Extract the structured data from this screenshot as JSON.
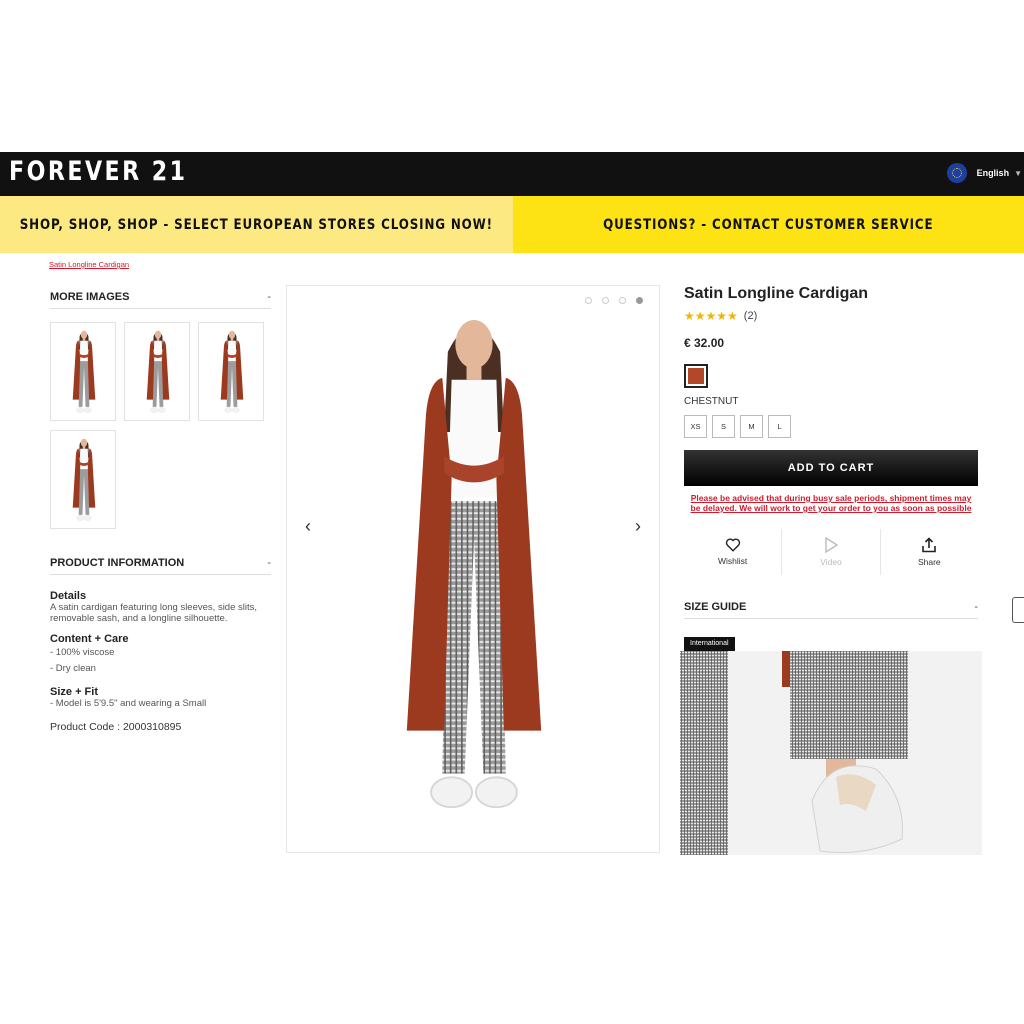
{
  "header": {
    "logo": "FOREVER 21",
    "language": "English"
  },
  "promo": {
    "left": "SHOP, SHOP, SHOP - SELECT EUROPEAN STORES CLOSING NOW!",
    "right": "QUESTIONS? - CONTACT CUSTOMER SERVICE"
  },
  "breadcrumb": "Satin Longline Cardigan",
  "more_images": {
    "heading": "MORE IMAGES",
    "toggle": "-"
  },
  "product_info": {
    "heading": "PRODUCT INFORMATION",
    "toggle": "-",
    "details_title": "Details",
    "details_text": "A satin cardigan featuring long sleeves, side slits, removable sash, and a longline silhouette.",
    "content_title": "Content + Care",
    "content_lines": [
      "- 100% viscose",
      "- Dry clean"
    ],
    "fit_title": "Size + Fit",
    "fit_text": "- Model is 5'9.5\" and wearing a Small",
    "product_code": "Product Code : 2000310895"
  },
  "product": {
    "title": "Satin Longline Cardigan",
    "rating_count": "(2)",
    "rating_value": 5,
    "price": "€ 32.00",
    "color_name": "CHESTNUT",
    "color_hex": "#b3472a",
    "sizes": [
      "XS",
      "S",
      "M",
      "L"
    ],
    "add_to_cart": "ADD TO CART",
    "notice": "Please be advised that during busy sale periods, shipment times may be delayed. We will work to get your order to you as soon as possible"
  },
  "actions": {
    "wishlist": "Wishlist",
    "video": "Video",
    "share": "Share"
  },
  "size_guide": {
    "heading": "SIZE GUIDE",
    "toggle": "-",
    "tab": "International"
  },
  "carousel": {
    "prev_icon": "chevron-left-icon",
    "next_icon": "chevron-right-icon",
    "active_slide": 4,
    "total_slides": 4
  },
  "colors": {
    "topbar": "#111111",
    "promo_left": "#fde981",
    "promo_right": "#fde314",
    "accent_red": "#d11b2c",
    "cardigan": "#b3472a"
  }
}
